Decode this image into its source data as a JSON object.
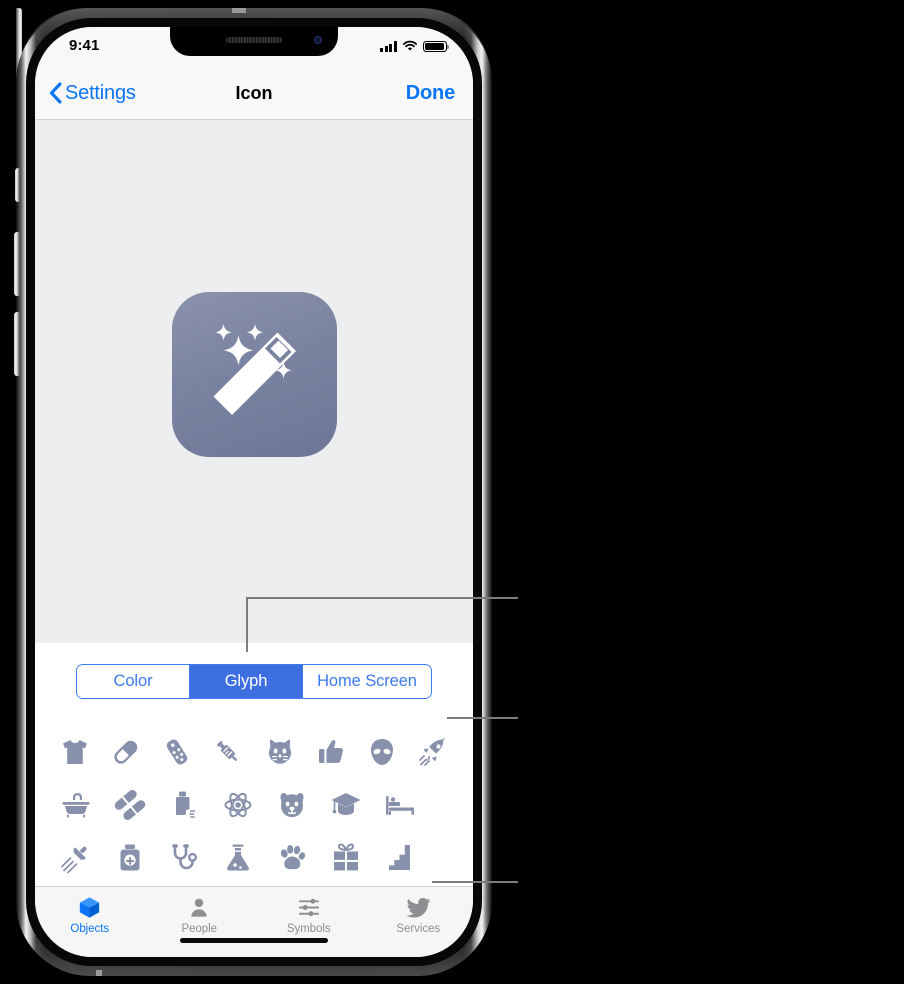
{
  "status_bar": {
    "time": "9:41",
    "signal_icon": "cellular-signal-icon",
    "wifi_icon": "wifi-icon",
    "battery_icon": "battery-icon"
  },
  "nav_bar": {
    "back_label": "Settings",
    "back_icon": "chevron-left-icon",
    "title": "Icon",
    "done_label": "Done"
  },
  "preview": {
    "app_icon_name": "magic-wand-app-icon",
    "icon_background_gradient": [
      "#8b93ab",
      "#6d7694"
    ],
    "wand_color": "#ffffff"
  },
  "segmented_control": {
    "accent_color": "#3d7aec",
    "selected_fill": "#3d6fe0",
    "selected": "Glyph",
    "options": [
      {
        "label": "Color",
        "selected": false
      },
      {
        "label": "Glyph",
        "selected": true
      },
      {
        "label": "Home Screen",
        "selected": false
      }
    ]
  },
  "glyph_grid": {
    "glyph_color": "#8791ab",
    "rows": [
      [
        {
          "name": "tshirt-glyph"
        },
        {
          "name": "pill-capsule-glyph"
        },
        {
          "name": "game-controller-glyph"
        },
        {
          "name": "syringe-glyph"
        },
        {
          "name": "cat-face-glyph"
        },
        {
          "name": "thumbs-up-glyph"
        },
        {
          "name": "alien-glyph"
        },
        {
          "name": "rocket-glyph"
        }
      ],
      [
        {
          "name": "bathtub-glyph"
        },
        {
          "name": "two-pills-glyph"
        },
        {
          "name": "inhaler-glyph"
        },
        {
          "name": "atom-glyph"
        },
        {
          "name": "dog-face-glyph"
        },
        {
          "name": "graduation-cap-glyph"
        },
        {
          "name": "bed-glyph"
        }
      ],
      [
        {
          "name": "shower-glyph"
        },
        {
          "name": "medicine-bottle-glyph"
        },
        {
          "name": "stethoscope-glyph"
        },
        {
          "name": "flask-glyph"
        },
        {
          "name": "paw-print-glyph"
        },
        {
          "name": "gift-glyph"
        },
        {
          "name": "stairs-glyph"
        }
      ]
    ]
  },
  "tab_bar": {
    "selected_color": "#0a76f5",
    "unselected_color": "#8e8e93",
    "tabs": [
      {
        "label": "Objects",
        "icon": "cube-icon",
        "selected": true
      },
      {
        "label": "People",
        "icon": "person-icon",
        "selected": false
      },
      {
        "label": "Symbols",
        "icon": "sliders-icon",
        "selected": false
      },
      {
        "label": "Services",
        "icon": "bird-icon",
        "selected": false
      }
    ]
  },
  "callouts": {
    "line_color": "#7d7d7d",
    "targets": [
      {
        "name": "callout-segmented-control"
      },
      {
        "name": "callout-glyph-grid"
      },
      {
        "name": "callout-tab-bar"
      }
    ]
  }
}
